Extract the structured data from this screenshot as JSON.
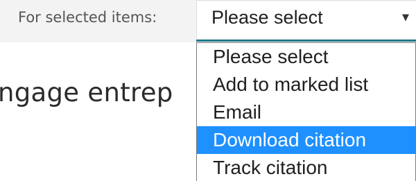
{
  "toolbar": {
    "label": "For selected items:",
    "select_value": "Please select",
    "chevron_glyph": "▼"
  },
  "background": {
    "heading_fragment": "ngage entrep"
  },
  "dropdown": {
    "options": [
      {
        "label": "Please select",
        "highlighted": false
      },
      {
        "label": "Add to marked list",
        "highlighted": false
      },
      {
        "label": "Email",
        "highlighted": false
      },
      {
        "label": "Download citation",
        "highlighted": true
      },
      {
        "label": "Track citation",
        "highlighted": false
      }
    ]
  },
  "colors": {
    "highlight": "#1e90ff",
    "focus_underline": "#1f7a8c",
    "toolbar_bg": "#f3f3f3"
  }
}
